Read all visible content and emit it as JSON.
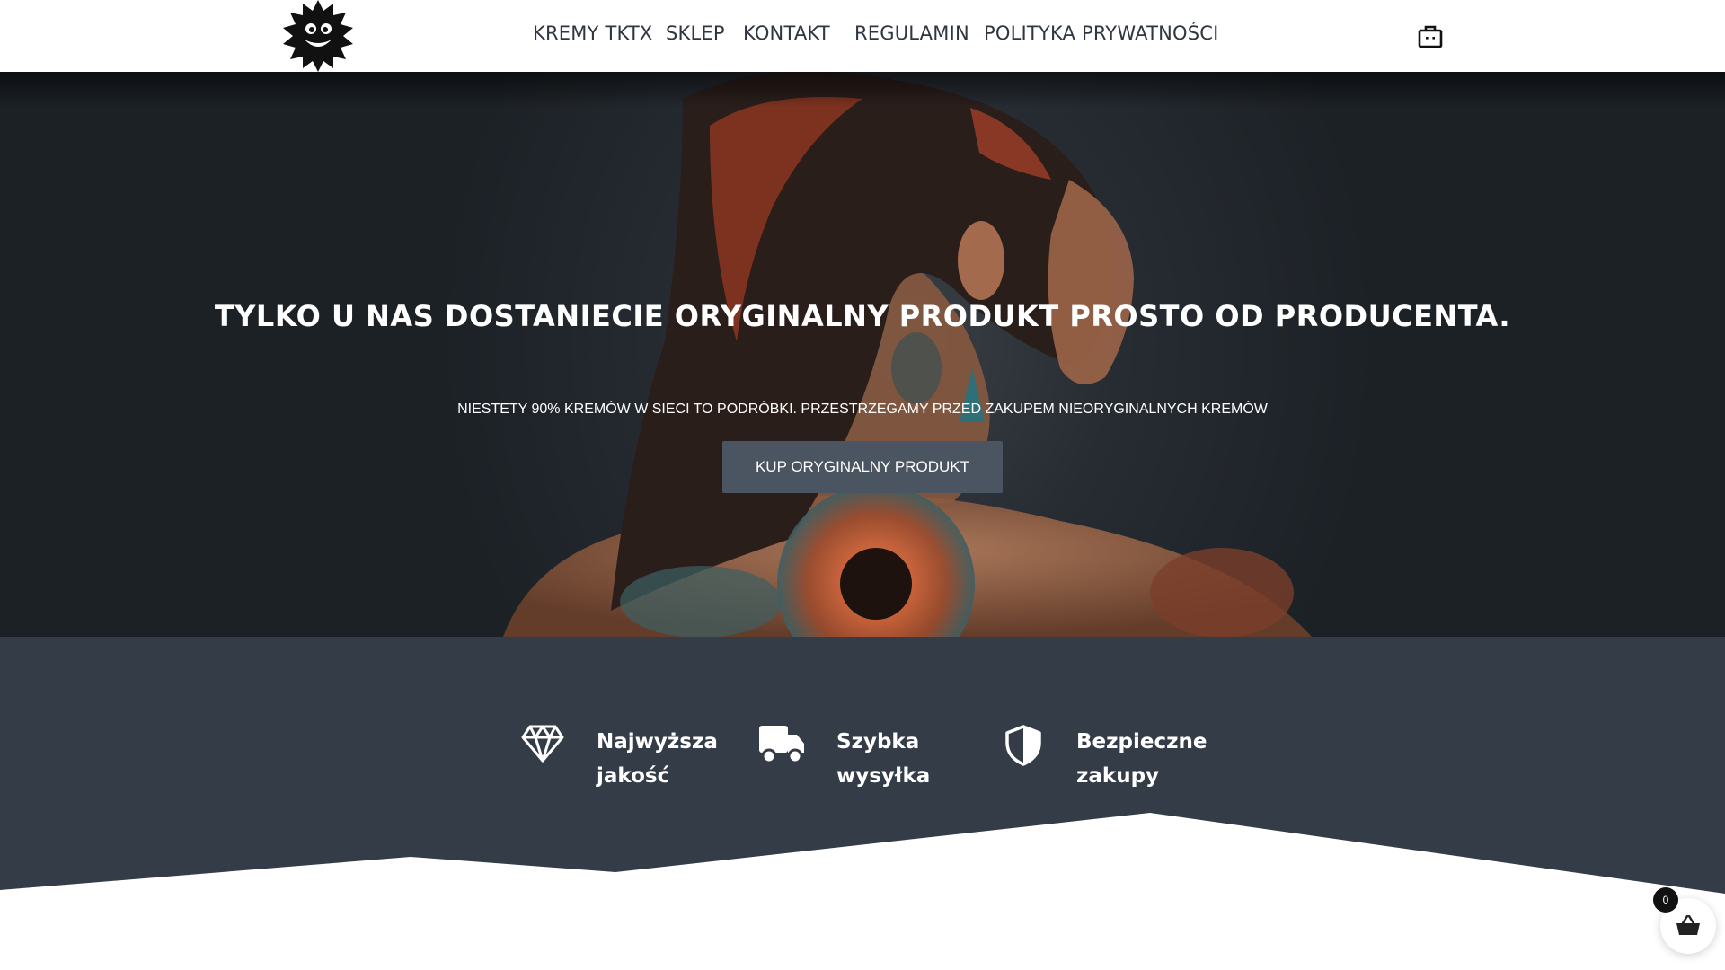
{
  "nav": {
    "items": [
      {
        "label": "KREMY TKTX"
      },
      {
        "label": "SKLEP"
      },
      {
        "label": "KONTAKT"
      },
      {
        "label": "REGULAMIN"
      },
      {
        "label": "POLITYKA PRYWATNOŚCI"
      }
    ],
    "logo_icon": "grinning-sun-logo",
    "cart_icon": "shopping-bag-icon"
  },
  "hero": {
    "title": "TYLKO U NAS DOSTANIECIE ORYGINALNY PRODUKT PROSTO OD PRODUCENTA.",
    "subtitle": "NIESTETY 90% KREMÓW W SIECI TO PODRÓBKI. PRZESTRZEGAMY PRZED ZAKUPEM NIEORYGINALNYCH KREMÓW",
    "button_label": "KUP ORYGINALNY PRODUKT"
  },
  "features": [
    {
      "icon": "diamond-icon",
      "line1": "Najwyższa",
      "line2": "jakość"
    },
    {
      "icon": "truck-icon",
      "line1": "Szybka",
      "line2": "wysyłka"
    },
    {
      "icon": "shield-icon",
      "line1": "Bezpieczne",
      "line2": "zakupy"
    }
  ],
  "floating_cart": {
    "icon": "basket-icon",
    "count": "0"
  },
  "colors": {
    "accent_dark": "#343d47",
    "button": "#4b5461",
    "nav_text": "#2f3640"
  }
}
